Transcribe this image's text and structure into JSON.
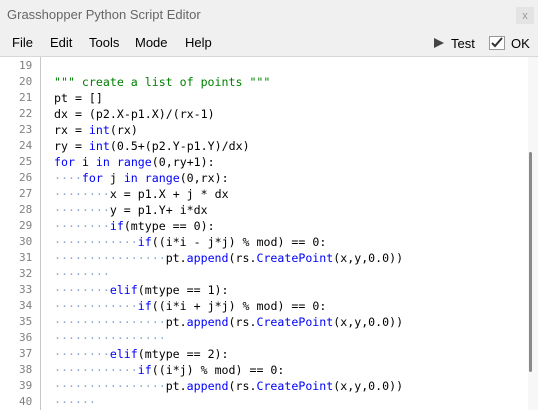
{
  "window": {
    "title": "Grasshopper Python Script Editor",
    "close_label": "x"
  },
  "menu": {
    "items": [
      "File",
      "Edit",
      "Tools",
      "Mode",
      "Help"
    ],
    "test_label": "Test",
    "ok_label": "OK"
  },
  "editor": {
    "lines": [
      {
        "num": "19",
        "dots": "",
        "code": ""
      },
      {
        "num": "20",
        "dots": "",
        "code": "\"\"\" create a list of points \"\"\""
      },
      {
        "num": "21",
        "dots": "",
        "code": "pt = []"
      },
      {
        "num": "22",
        "dots": "",
        "code": "dx = (p2.X-p1.X)/(rx-1)"
      },
      {
        "num": "23",
        "dots": "",
        "code": "rx = int(rx)"
      },
      {
        "num": "24",
        "dots": "",
        "code": "ry = int(0.5+(p2.Y-p1.Y)/dx)"
      },
      {
        "num": "25",
        "dots": "",
        "code": "for i in range(0,ry+1):"
      },
      {
        "num": "26",
        "dots": "····",
        "code": "for j in range(0,rx):"
      },
      {
        "num": "27",
        "dots": "········",
        "code": "x = p1.X + j * dx"
      },
      {
        "num": "28",
        "dots": "········",
        "code": "y = p1.Y+ i*dx"
      },
      {
        "num": "29",
        "dots": "········",
        "code": "if(mtype == 0):"
      },
      {
        "num": "30",
        "dots": "············",
        "code": "if((i*i - j*j) % mod) == 0:"
      },
      {
        "num": "31",
        "dots": "················",
        "code": "pt.append(rs.CreatePoint(x,y,0.0))"
      },
      {
        "num": "32",
        "dots": "········",
        "code": ""
      },
      {
        "num": "33",
        "dots": "········",
        "code": "elif(mtype == 1):"
      },
      {
        "num": "34",
        "dots": "············",
        "code": "if((i*i + j*j) % mod) == 0:"
      },
      {
        "num": "35",
        "dots": "················",
        "code": "pt.append(rs.CreatePoint(x,y,0.0))"
      },
      {
        "num": "36",
        "dots": "················",
        "code": ""
      },
      {
        "num": "37",
        "dots": "········",
        "code": "elif(mtype == 2):"
      },
      {
        "num": "38",
        "dots": "············",
        "code": "if((i*j) % mod) == 0:"
      },
      {
        "num": "39",
        "dots": "················",
        "code": "pt.append(rs.CreatePoint(x,y,0.0))"
      },
      {
        "num": "40",
        "dots": "······",
        "code": ""
      }
    ]
  }
}
